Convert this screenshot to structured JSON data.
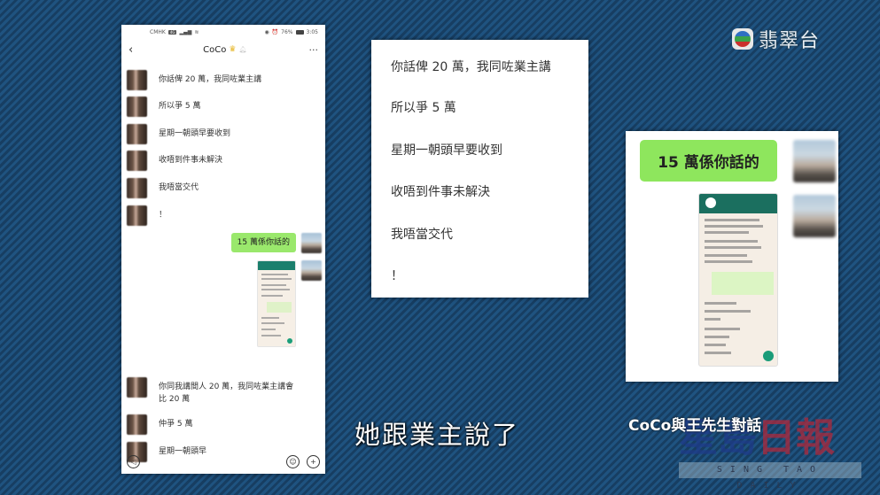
{
  "phone": {
    "statusbar": {
      "carrier": "CMHK",
      "carrier_badge": "4G",
      "signal": "´‥❙",
      "battery_percent": "76%",
      "time": "3:05"
    },
    "navbar": {
      "back_icon": "‹",
      "title": "CoCo",
      "crown_icon": "👑",
      "bell_icon": "⌂",
      "more_icon": "···"
    },
    "messages_top": [
      {
        "text": "你話俾 20 萬，我同咗業主講"
      },
      {
        "text": "所以爭 5 萬"
      },
      {
        "text": "星期一朝頭早要收到"
      },
      {
        "text": "收唔到件事未解決"
      },
      {
        "text": "我唔當交代"
      },
      {
        "text": "！"
      }
    ],
    "my_reply": "15 萬係你話的",
    "messages_bottom": [
      {
        "text": "你同我講間人 20 萬，我同咗業主講會比 20 萬"
      },
      {
        "text": "仲爭 5 萬"
      },
      {
        "text": "星期一朝頭早"
      }
    ],
    "bottombar": {
      "voice_icon": "◁)",
      "emoji_icon": "☺",
      "plus_icon": "+"
    }
  },
  "zoom_panel": {
    "lines": [
      "你話俾 20 萬，我同咗業主講",
      "所以爭 5 萬",
      "星期一朝頭早要收到",
      "收唔到件事未解決",
      "我唔當交代",
      "！"
    ]
  },
  "reply_panel": {
    "bubble": "15 萬係你話的"
  },
  "overlay": {
    "subtitle": "她跟業主說了",
    "caption": "CoCo與王先生對話",
    "tvb_channel": "翡翠台",
    "watermark_cn_blue": "星島",
    "watermark_cn_red": "日報",
    "watermark_en": "SING TAO DAILY"
  },
  "colors": {
    "background": "#1d4a72",
    "bubble_green": "#9ae86c",
    "whatsapp_header": "#1b7f6d"
  }
}
